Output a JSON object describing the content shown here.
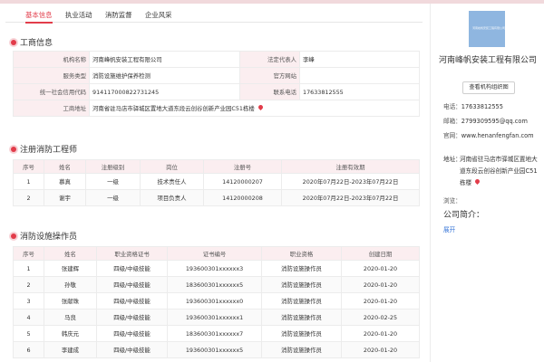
{
  "tabs": [
    "基本信息",
    "执业活动",
    "消防监督",
    "企业风采"
  ],
  "sections": {
    "business": "工商信息",
    "engineers": "注册消防工程师",
    "operators": "消防设施操作员"
  },
  "business": {
    "name_label": "机构名称",
    "name": "河南峰帆安装工程有限公司",
    "legal_label": "法定代表人",
    "legal": "李峰",
    "service_label": "服务类型",
    "service": "消防设施维护保养检测",
    "site_label": "官方网站",
    "site": "",
    "credit_label": "统一社会信用代码",
    "credit": "914117000822731245",
    "phone_label": "联系电话",
    "phone": "17633812555",
    "address_label": "工商地址",
    "address": "河南省驻马店市驿城区置地大道东段云创谷创新产业园C51栋楼"
  },
  "engineers": {
    "headers": [
      "序号",
      "姓名",
      "注册级别",
      "岗位",
      "注册号",
      "注册有效期"
    ],
    "rows": [
      [
        "1",
        "慕真",
        "一级",
        "技术责任人",
        "14120000207",
        "2020年07月22日-2023年07月22日"
      ],
      [
        "2",
        "谢宇",
        "一级",
        "项目负责人",
        "14120000208",
        "2020年07月22日-2023年07月22日"
      ]
    ]
  },
  "operators": {
    "headers": [
      "序号",
      "姓名",
      "职业资格证书",
      "证书编号",
      "职业资格",
      "创建日期"
    ],
    "rows": [
      [
        "1",
        "张建辉",
        "四级/中级技能",
        "193600301xxxxxx3",
        "消防设施操作员",
        "2020-01-20"
      ],
      [
        "2",
        "孙敬",
        "四级/中级技能",
        "183600301xxxxxx5",
        "消防设施操作员",
        "2020-01-20"
      ],
      [
        "3",
        "张献珠",
        "四级/中级技能",
        "193600301xxxxxx0",
        "消防设施操作员",
        "2020-01-20"
      ],
      [
        "4",
        "马良",
        "四级/中级技能",
        "193600301xxxxxx1",
        "消防设施操作员",
        "2020-02-25"
      ],
      [
        "5",
        "韩庆元",
        "四级/中级技能",
        "183600301xxxxxx7",
        "消防设施操作员",
        "2020-01-20"
      ],
      [
        "6",
        "李建成",
        "四级/中级技能",
        "193600301xxxxxx5",
        "消防设施操作员",
        "2020-01-20"
      ]
    ]
  },
  "sidebar": {
    "company": "河南峰帆安装工程有限公司",
    "chart_button": "查看机构组织图",
    "phone_label": "电话：",
    "phone": "17633812555",
    "email_label": "邮箱：",
    "email": "2799309595@qq.com",
    "site_label": "官网：",
    "site": "www.henanfengfan.com",
    "address_label": "地址：",
    "address": "河南省驻马店市驿城区置地大道东段云创谷创新产业园C51栋楼",
    "browse_label": "浏览：",
    "browse": "",
    "intro_title": "公司简介：",
    "expand": "展开"
  },
  "colors": {
    "accent": "#e23c4a",
    "label_bg": "#fbeef0",
    "link": "#2e6fd6"
  },
  "icons": [
    "map-pin-icon",
    "section-dot-icon"
  ]
}
